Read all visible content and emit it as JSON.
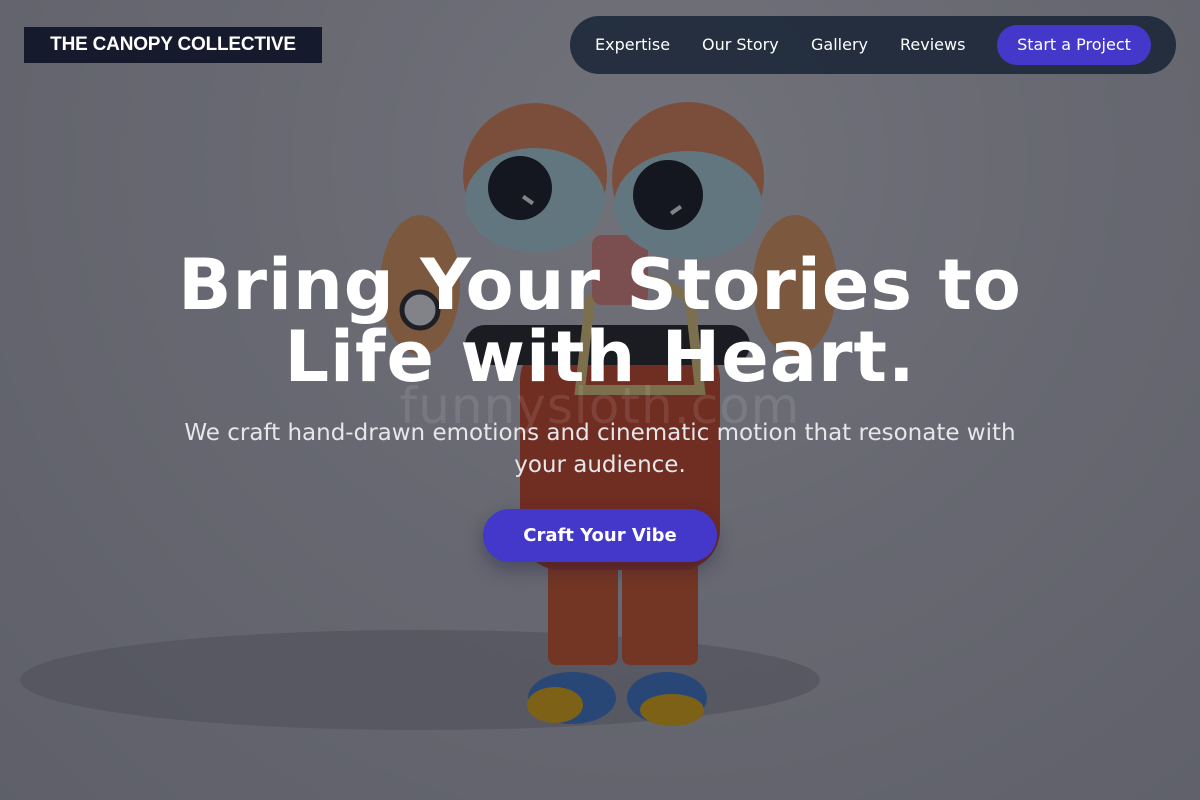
{
  "brand": {
    "logo_text": "THE CANOPY COLLECTIVE"
  },
  "nav": {
    "links": [
      {
        "label": "Expertise"
      },
      {
        "label": "Our Story"
      },
      {
        "label": "Gallery"
      },
      {
        "label": "Reviews"
      }
    ],
    "cta_label": "Start a Project"
  },
  "hero": {
    "headline": "Bring Your Stories to Life with Heart.",
    "subheadline": "We craft hand-drawn emotions and cinematic motion that resonate with your audience.",
    "cta_label": "Craft Your Vibe",
    "watermark": "funnysloth.com",
    "background_subject": "orange cartoon character with big eyes, raised hands, red overalls and yellow-blue shoes"
  },
  "colors": {
    "accent": "#4338ca",
    "nav_background": "#1e293b",
    "logo_background": "#151b2c",
    "overlay": "#1c1e28",
    "text_primary": "#ffffff"
  }
}
